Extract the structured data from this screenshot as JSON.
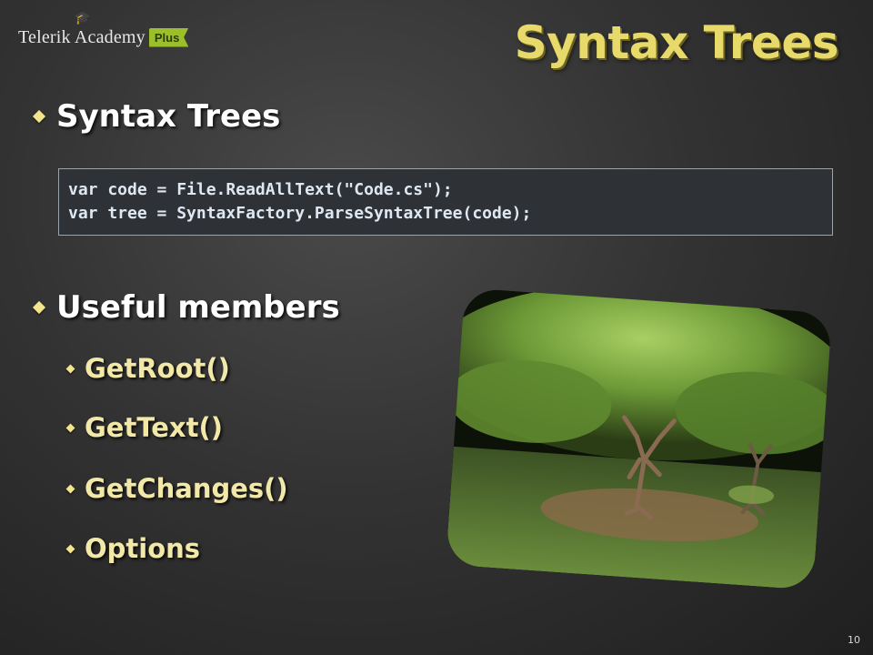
{
  "logo": {
    "text": "Telerik Academy",
    "plus": "Plus"
  },
  "slide": {
    "title": "Syntax Trees",
    "bullets": [
      {
        "text": "Syntax Trees"
      },
      {
        "text": "Useful members"
      }
    ],
    "code": [
      "var code = File.ReadAllText(\"Code.cs\");",
      "var tree = SyntaxFactory.ParseSyntaxTree(code);"
    ],
    "subbullets": [
      {
        "text": "GetRoot()"
      },
      {
        "text": "GetText()"
      },
      {
        "text": "GetChanges()"
      },
      {
        "text": "Options"
      }
    ],
    "photo_subject": "tree-sculpture-photo",
    "page_number": "10"
  },
  "colors": {
    "title": "#e7d96a",
    "bullet_mark": "#f2e58c",
    "subbullet_text": "#f2e8a8",
    "logo_plus": "#9bbf2a"
  }
}
